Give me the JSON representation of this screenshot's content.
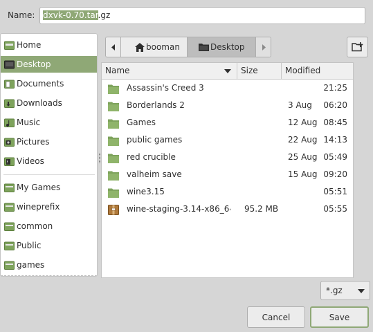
{
  "name_field": {
    "label": "Name:",
    "value_selected": "dxvk-0.70.tar",
    "value_rest": ".gz"
  },
  "sidebar": {
    "items": [
      {
        "label": "Home",
        "icon": "home-folder-icon"
      },
      {
        "label": "Desktop",
        "icon": "desktop-icon",
        "active": true
      },
      {
        "label": "Documents",
        "icon": "documents-folder-icon"
      },
      {
        "label": "Downloads",
        "icon": "downloads-folder-icon"
      },
      {
        "label": "Music",
        "icon": "music-folder-icon"
      },
      {
        "label": "Pictures",
        "icon": "pictures-folder-icon"
      },
      {
        "label": "Videos",
        "icon": "videos-folder-icon"
      }
    ],
    "bookmarks": [
      {
        "label": "My Games",
        "icon": "folder-icon"
      },
      {
        "label": "wineprefix",
        "icon": "folder-icon"
      },
      {
        "label": "common",
        "icon": "folder-icon"
      },
      {
        "label": "Public",
        "icon": "folder-icon"
      },
      {
        "label": "games",
        "icon": "folder-icon"
      }
    ]
  },
  "pathbar": {
    "segments": [
      "booman",
      "Desktop"
    ],
    "current": "Desktop"
  },
  "columns": {
    "name": "Name",
    "size": "Size",
    "modified": "Modified"
  },
  "files": [
    {
      "name": "Assassin's Creed 3",
      "size": "",
      "date": "",
      "time": "21:25",
      "type": "folder"
    },
    {
      "name": "Borderlands 2",
      "size": "",
      "date": "3 Aug",
      "time": "06:20",
      "type": "folder"
    },
    {
      "name": "Games",
      "size": "",
      "date": "12 Aug",
      "time": "08:45",
      "type": "folder"
    },
    {
      "name": "public games",
      "size": "",
      "date": "22 Aug",
      "time": "14:13",
      "type": "folder"
    },
    {
      "name": "red crucible",
      "size": "",
      "date": "25 Aug",
      "time": "05:49",
      "type": "folder"
    },
    {
      "name": "valheim save",
      "size": "",
      "date": "15 Aug",
      "time": "09:20",
      "type": "folder"
    },
    {
      "name": "wine3.15",
      "size": "",
      "date": "",
      "time": "05:51",
      "type": "folder"
    },
    {
      "name": "wine-staging-3.14-x86_64....",
      "size": "95.2 MB",
      "date": "",
      "time": "05:55",
      "type": "archive"
    }
  ],
  "filter": {
    "value": "*.gz"
  },
  "buttons": {
    "cancel": "Cancel",
    "save": "Save"
  },
  "colors": {
    "accent": "#8fa876",
    "folder": "#7ea35c",
    "window_bg": "#d6d6d6"
  }
}
